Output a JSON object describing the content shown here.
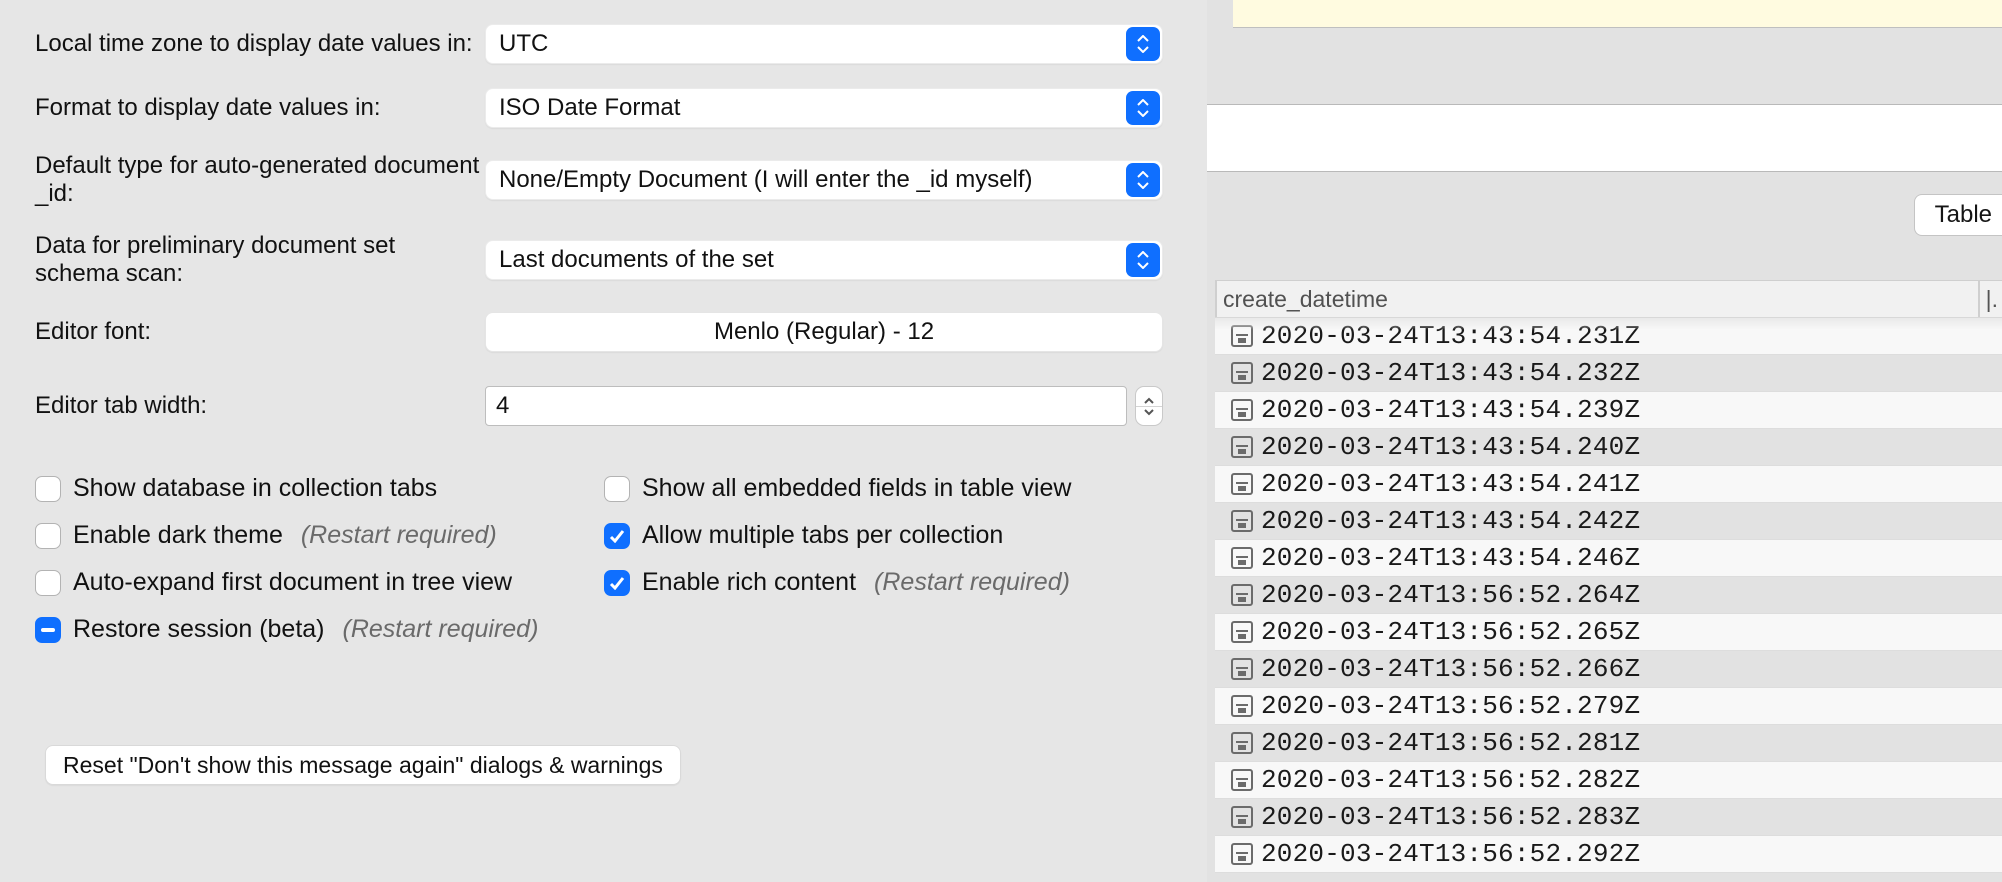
{
  "settings": {
    "rows": [
      {
        "label": "Local time zone to display date values in:",
        "value": "UTC"
      },
      {
        "label": "Format to display date values in:",
        "value": "ISO Date Format"
      },
      {
        "label": "Default type for auto-generated document _id:",
        "value": "None/Empty Document (I will enter the _id myself)"
      },
      {
        "label": "Data for preliminary document set schema scan:",
        "value": "Last documents of the set"
      }
    ],
    "editor_font_label": "Editor font:",
    "editor_font_value": "Menlo (Regular) - 12",
    "tab_width_label": "Editor tab width:",
    "tab_width_value": "4",
    "checks": {
      "show_db_tabs": {
        "label": "Show database in collection tabs",
        "checked": false
      },
      "show_all_fields": {
        "label": "Show all embedded fields in table view",
        "checked": false
      },
      "dark_theme": {
        "label": "Enable dark theme",
        "checked": false,
        "hint": "(Restart required)"
      },
      "multi_tabs": {
        "label": "Allow multiple tabs per collection",
        "checked": true
      },
      "auto_expand": {
        "label": "Auto-expand first document in tree view",
        "checked": false
      },
      "rich_content": {
        "label": "Enable rich content",
        "checked": true,
        "hint": "(Restart required)"
      },
      "restore_session": {
        "label": "Restore session (beta)",
        "checked": "mixed",
        "hint": "(Restart required)"
      }
    },
    "reset_button": "Reset \"Don't show this message again\" dialogs & warnings"
  },
  "right": {
    "table_button": "Table",
    "column_header": "create_datetime",
    "column_tail": "|.",
    "rows": [
      "2020-03-24T13:43:54.231Z",
      "2020-03-24T13:43:54.232Z",
      "2020-03-24T13:43:54.239Z",
      "2020-03-24T13:43:54.240Z",
      "2020-03-24T13:43:54.241Z",
      "2020-03-24T13:43:54.242Z",
      "2020-03-24T13:43:54.246Z",
      "2020-03-24T13:56:52.264Z",
      "2020-03-24T13:56:52.265Z",
      "2020-03-24T13:56:52.266Z",
      "2020-03-24T13:56:52.279Z",
      "2020-03-24T13:56:52.281Z",
      "2020-03-24T13:56:52.282Z",
      "2020-03-24T13:56:52.283Z",
      "2020-03-24T13:56:52.292Z"
    ]
  }
}
